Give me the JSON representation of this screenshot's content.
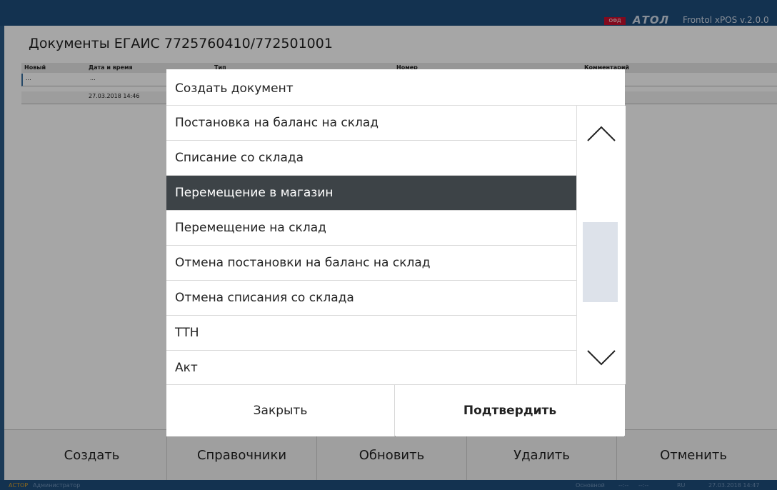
{
  "topbar": {
    "ofd": "ОФД",
    "brand": "АТОЛ",
    "version": "Frontol xPOS v.2.0.0"
  },
  "window": {
    "title": "Документы ЕГАИС 7725760410/772501001"
  },
  "table": {
    "headers": [
      "Новый",
      "Дата и время",
      "Тип",
      "Номер",
      "Комментарий"
    ],
    "rows": [
      [
        "...",
        "...",
        "",
        "",
        ""
      ],
      [
        "",
        "27.03.2018 14:46",
        "",
        "",
        ""
      ]
    ]
  },
  "bottom_buttons": [
    "Создать",
    "Справочники",
    "Обновить",
    "Удалить",
    "Отменить"
  ],
  "status": {
    "cashier_label": "АСТОР",
    "cashier_name": "Администратор",
    "mode": "Основной",
    "t1": "--:--",
    "t2": "--:--",
    "lang": "RU",
    "datetime": "27.03.2018 14:47"
  },
  "dialog": {
    "title": "Создать документ",
    "items": [
      "Постановка на баланс на склад",
      "Списание со склада",
      "Перемещение в магазин",
      "Перемещение на склад",
      "Отмена постановки на баланс на склад",
      "Отмена списания со склада",
      "ТТН",
      "Акт"
    ],
    "selected_index": 2,
    "close_label": "Закрыть",
    "confirm_label": "Подтвердить"
  },
  "colors": {
    "selected_item_bg": "#3d4347",
    "topbar_bg": "#1e4d7c",
    "ofd_badge": "#c8102e"
  },
  "icons": {
    "scroll_up": "chevron-up-icon",
    "scroll_down": "chevron-down-icon"
  }
}
